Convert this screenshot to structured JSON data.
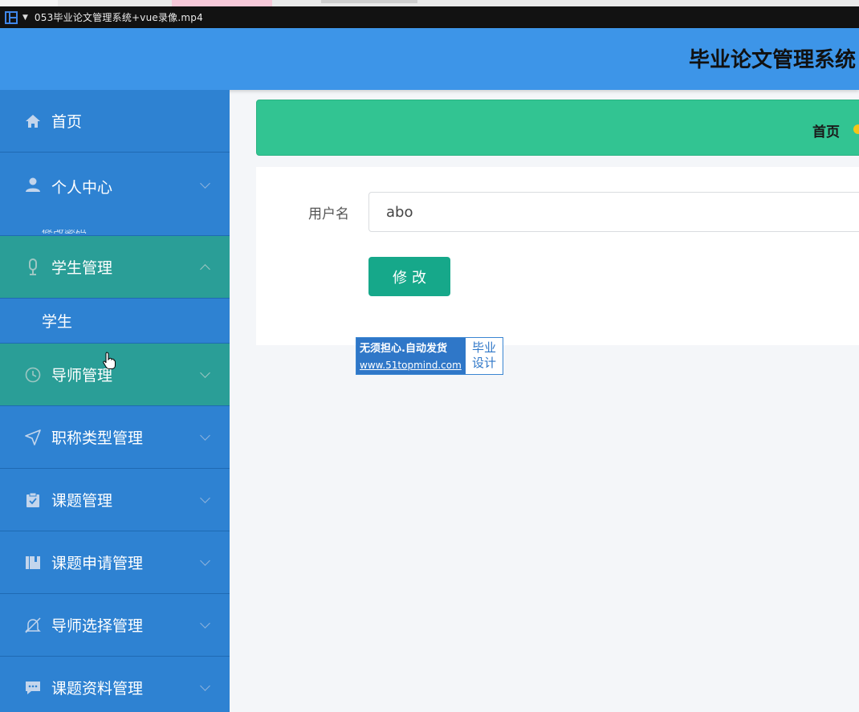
{
  "window": {
    "file_title": "053毕业论文管理系统+vue录像.mp4"
  },
  "header": {
    "system_title": "毕业论文管理系统"
  },
  "sidebar": {
    "items": [
      {
        "label": "首页",
        "icon": "home-icon"
      },
      {
        "label": "个人中心",
        "icon": "user-icon",
        "sub_clipped": "修改密码"
      },
      {
        "label": "学生管理",
        "icon": "microphone-icon",
        "expanded": true,
        "sub": [
          "学生"
        ]
      },
      {
        "label": "导师管理",
        "icon": "clock-icon"
      },
      {
        "label": "职称类型管理",
        "icon": "send-icon"
      },
      {
        "label": "课题管理",
        "icon": "clipboard-icon"
      },
      {
        "label": "课题申请管理",
        "icon": "book-icon"
      },
      {
        "label": "导师选择管理",
        "icon": "bell-off-icon"
      },
      {
        "label": "课题资料管理",
        "icon": "chat-icon"
      }
    ]
  },
  "breadcrumb": {
    "current": "首页"
  },
  "form": {
    "username_label": "用户名",
    "username_value": "abo",
    "submit_label": "修改"
  },
  "watermark": {
    "line1": "无须担心.自动发货",
    "line2": "www.51topmind.com",
    "right_line1": "毕业",
    "right_line2": "设计"
  },
  "colors": {
    "header": "#3d95e8",
    "sidebar": "#2e82d2",
    "sidebar_active": "#2a9e97",
    "breadcrumb_bar": "#32c492",
    "primary_button": "#16a88a"
  }
}
